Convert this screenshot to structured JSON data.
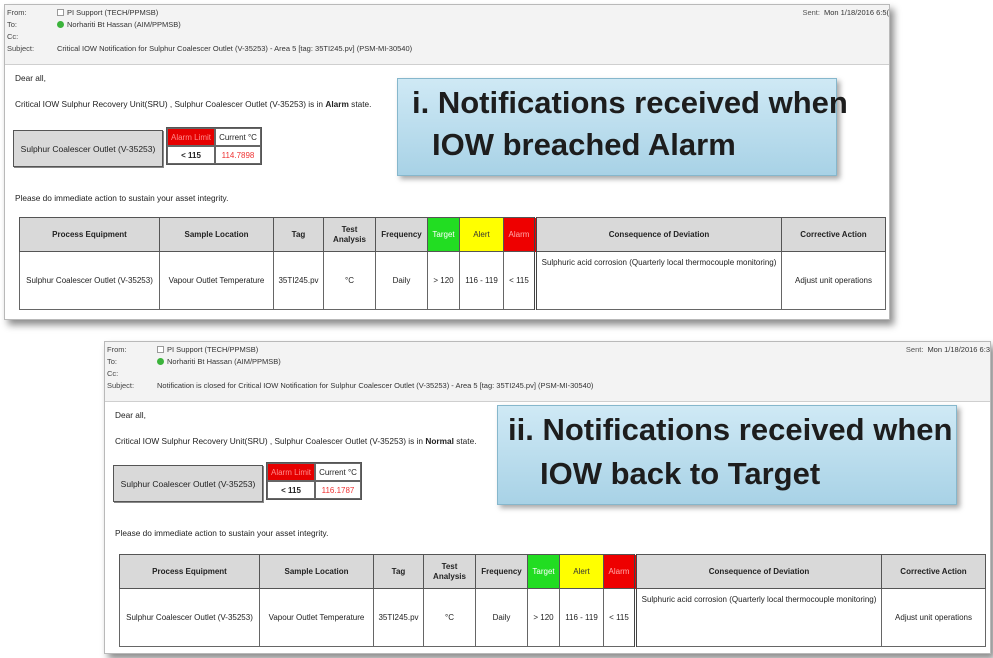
{
  "email1": {
    "header": {
      "from_label": "From:",
      "from": "PI Support (TECH/PPMSB)",
      "to_label": "To:",
      "to": "Norhariti Bt Hassan (AIM/PPMSB)",
      "cc_label": "Cc:",
      "cc": "",
      "subject_label": "Subject:",
      "subject": "Critical IOW Notification for Sulphur Coalescer Outlet (V-35253) - Area 5  [tag: 35TI245.pv] (PSM-MI-30540)",
      "sent_label": "Sent:",
      "sent": "Mon 1/18/2016 6:5("
    },
    "greeting": "Dear all,",
    "message_prefix": "Critical IOW Sulphur Recovery Unit(SRU) , Sulphur Coalescer Outlet (V-35253) is in ",
    "message_state": "Alarm",
    "message_suffix": " state.",
    "equipment": "Sulphur Coalescer Outlet (V-35253)",
    "alarm_limit_label": "Alarm Limit",
    "current_label": "Current °C",
    "alarm_limit": "< 115",
    "current_value": "114.7898",
    "action": "Please do immediate action to sustain your asset integrity.",
    "callout_line1": "i. Notifications received when",
    "callout_line2": "IOW breached Alarm"
  },
  "email2": {
    "header": {
      "from_label": "From:",
      "from": "PI Support (TECH/PPMSB)",
      "to_label": "To:",
      "to": "Norhariti Bt Hassan (AIM/PPMSB)",
      "cc_label": "Cc:",
      "cc": "",
      "subject_label": "Subject:",
      "subject": "Notification is closed for Critical IOW Notification for Sulphur Coalescer Outlet (V-35253) - Area 5  [tag: 35TI245.pv] (PSM-MI-30540)",
      "sent_label": "Sent:",
      "sent": "Mon 1/18/2016 6:3"
    },
    "greeting": "Dear all,",
    "message_prefix": "Critical IOW Sulphur Recovery Unit(SRU) , Sulphur Coalescer Outlet (V-35253) is in ",
    "message_state": "Normal",
    "message_suffix": " state.",
    "equipment": "Sulphur Coalescer Outlet (V-35253)",
    "alarm_limit_label": "Alarm Limit",
    "current_label": "Current °C",
    "alarm_limit": "< 115",
    "current_value": "116.1787",
    "action": "Please do immediate action to sustain your asset integrity.",
    "callout_line1": "ii. Notifications received when",
    "callout_line2": "IOW back to Target"
  },
  "table": {
    "headers": [
      "Process Equipment",
      "Sample Location",
      "Tag",
      "Test Analysis",
      "Frequency",
      "Target",
      "Alert",
      "Alarm",
      "Consequence of Deviation",
      "Corrective Action"
    ],
    "row": [
      "Sulphur Coalescer Outlet (V-35253)",
      "Vapour Outlet Temperature",
      "35TI245.pv",
      "°C",
      "Daily",
      "> 120",
      "116 - 119",
      "< 115",
      "Sulphuric acid corrosion (Quarterly local thermocouple monitoring)",
      "Adjust unit operations"
    ]
  },
  "colors": {
    "target": "#22dd22",
    "alert": "#ffff00",
    "alarm": "#ee0000",
    "callout": "#a8d2e6"
  }
}
